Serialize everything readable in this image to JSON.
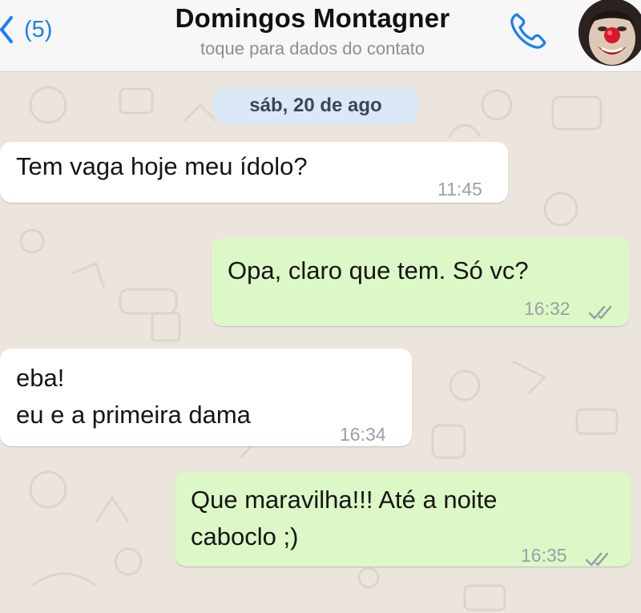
{
  "header": {
    "back_count": "(5)",
    "contact_name": "Domingos Montagner",
    "subtitle": "toque para dados do contato"
  },
  "icons": {
    "back": "chevron-left-icon",
    "call": "phone-icon",
    "read_receipt": "double-check-icon"
  },
  "chat": {
    "date_label": "sáb, 20 de ago",
    "messages": [
      {
        "direction": "incoming",
        "lines": [
          "Tem vaga hoje meu ídolo?"
        ],
        "time": "11:45"
      },
      {
        "direction": "outgoing",
        "lines": [
          "Opa, claro que tem. Só vc?"
        ],
        "time": "16:32",
        "read": true
      },
      {
        "direction": "incoming",
        "lines": [
          "eba!",
          "eu e a primeira dama"
        ],
        "time": "16:34"
      },
      {
        "direction": "outgoing",
        "lines": [
          "Que maravilha!!! Até a noite",
          "caboclo ;)"
        ],
        "time": "16:35",
        "read": true
      }
    ]
  },
  "colors": {
    "accent": "#1a7ef5",
    "incoming_bubble": "#ffffff",
    "outgoing_bubble": "#dcf8c6",
    "wallpaper": "#ece5dd",
    "date_pill": "#dbe8f6"
  }
}
